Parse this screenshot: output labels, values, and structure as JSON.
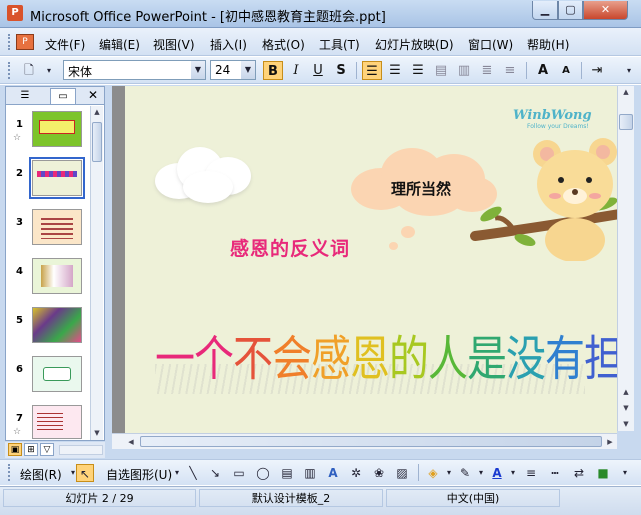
{
  "window": {
    "title": "Microsoft Office PowerPoint - [初中感恩教育主题班会.ppt]",
    "app_icon": "powerpoint-icon",
    "min_glyph": "▁",
    "max_glyph": "▢",
    "close_glyph": "✕"
  },
  "menu": {
    "items": [
      "文件(F)",
      "编辑(E)",
      "视图(V)",
      "插入(I)",
      "格式(O)",
      "工具(T)",
      "幻灯片放映(D)",
      "窗口(W)",
      "帮助(H)"
    ]
  },
  "toolbar": {
    "font_name": "宋体",
    "font_size": "24",
    "bold": "B",
    "italic": "I",
    "underline": "U",
    "shadow": "S",
    "grow_font": "A",
    "shrink_font": "A",
    "align_left_active": true
  },
  "panel": {
    "tab_outline_icon": "outline-icon",
    "tab_slides_icon": "slides-icon",
    "close": "✕",
    "slides": [
      {
        "num": "1",
        "star": "☆"
      },
      {
        "num": "2",
        "star": ""
      },
      {
        "num": "3",
        "star": ""
      },
      {
        "num": "4",
        "star": ""
      },
      {
        "num": "5",
        "star": ""
      },
      {
        "num": "6",
        "star": ""
      },
      {
        "num": "7",
        "star": "☆"
      }
    ],
    "selected": 2
  },
  "slide": {
    "bubble_text": "理所当然",
    "subtitle": "感恩的反义词",
    "main_text": "一个不会感恩的人是没有担当意识的",
    "main_text_colors": [
      "#e8297a",
      "#e8297a",
      "#e5533a",
      "#f07f2a",
      "#f0a028",
      "#e0c020",
      "#a8c820",
      "#58b838",
      "#30a870",
      "#2aa0b0",
      "#3080d0",
      "#4060d0",
      "#6048c8",
      "#7a30c0",
      "#8a28b8",
      "#9020b0"
    ],
    "logo_text": "WinbWong",
    "logo_sub": "Follow your Dreams!"
  },
  "drawbar": {
    "draw_label": "绘图(R)",
    "autoshapes_label": "自选图形(U)"
  },
  "status": {
    "slide_pos": "幻灯片 2 / 29",
    "template": "默认设计模板_2",
    "language": "中文(中国)"
  },
  "colors": {
    "slide_bg": "#eef1d8",
    "subtitle": "#e8297a",
    "bubble": "#fbd5b2",
    "accent_active": "#ffd37a"
  }
}
